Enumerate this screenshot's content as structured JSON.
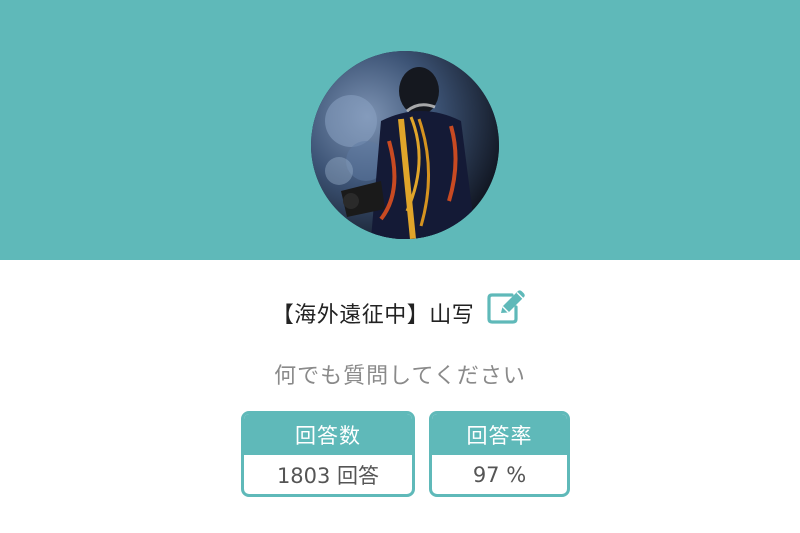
{
  "profile": {
    "name": "【海外遠征中】山写",
    "tagline": "何でも質問してください",
    "avatar_icon": "user-avatar-photo",
    "edit_icon": "edit-icon"
  },
  "stats": {
    "answers": {
      "label": "回答数",
      "value": "1803 回答"
    },
    "rate": {
      "label": "回答率",
      "value": "97 %"
    }
  },
  "colors": {
    "accent": "#5fb9b9",
    "background": "#ffffff",
    "text_primary": "#222222",
    "text_secondary": "#8a8a8a"
  }
}
